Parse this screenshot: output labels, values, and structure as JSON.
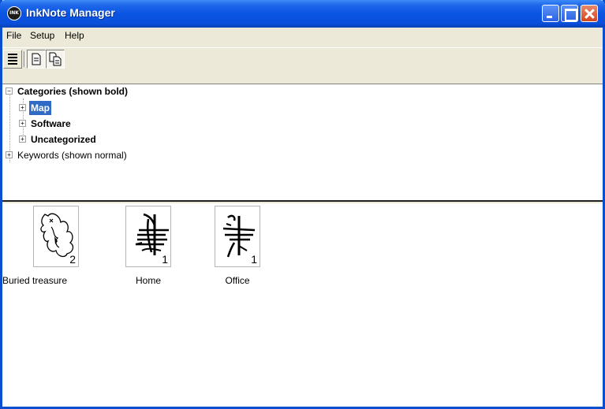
{
  "window": {
    "title": "InkNote Manager",
    "app_icon_text": "INK"
  },
  "menu": [
    "File",
    "Setup",
    "Help"
  ],
  "toolbar": {
    "buttons": [
      "list-view",
      "single-page",
      "multi-page"
    ]
  },
  "tree": {
    "root_categories": {
      "label": "Categories (shown bold)",
      "expanded": true
    },
    "categories": [
      {
        "label": "Map",
        "selected": true
      },
      {
        "label": "Software",
        "selected": false
      },
      {
        "label": "Uncategorized",
        "selected": false
      }
    ],
    "root_keywords": {
      "label": "Keywords (shown normal)",
      "expanded": false
    }
  },
  "notes": [
    {
      "label": "Buried treasure",
      "count": "2"
    },
    {
      "label": "Home",
      "count": "1"
    },
    {
      "label": "Office",
      "count": "1"
    }
  ]
}
